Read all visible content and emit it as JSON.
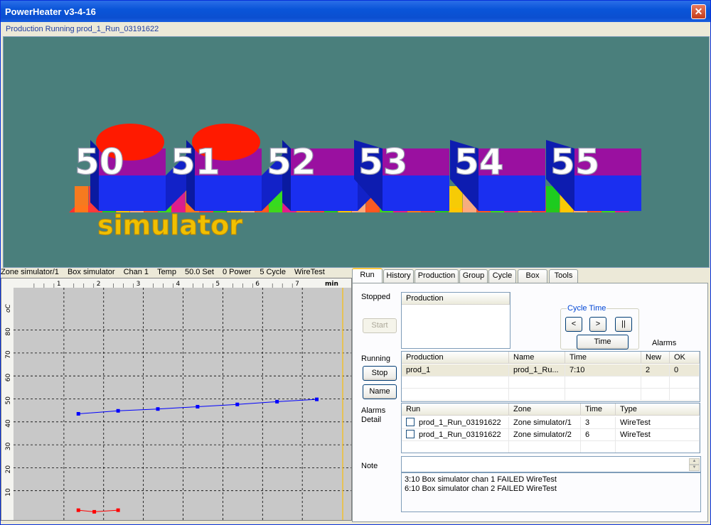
{
  "window": {
    "title": "PowerHeater  v3-4-16",
    "close_symbol": "✕",
    "status": "Production Running prod_1_Run_03191622"
  },
  "viewport": {
    "zones": [
      "50",
      "51",
      "52",
      "53",
      "54",
      "55"
    ],
    "alarm_zones": [
      "50",
      "51"
    ],
    "box_label": "simulator",
    "colors": {
      "background": "#4a7f7c",
      "box_front": "#1a2ff0",
      "box_top": "#9a10a0",
      "alarm": "#ff1a00",
      "label": "#f0c000"
    }
  },
  "chart_header": {
    "zone": "Zone simulator/1",
    "box": "Box simulator",
    "chan": "Chan 1",
    "temp": "Temp",
    "set": "50.0 Set",
    "power": "0 Power",
    "cycle": "5 Cycle",
    "test": "WireTest"
  },
  "chart_data": {
    "type": "line",
    "xlabel": "min",
    "ylabel": "oC",
    "xlim": [
      0,
      8.5
    ],
    "ylim": [
      0,
      90
    ],
    "x_ticks": [
      "1",
      "2",
      "3",
      "4",
      "5",
      "6",
      "7"
    ],
    "y_ticks": [
      "10",
      "20",
      "30",
      "40",
      "50",
      "60",
      "70",
      "80"
    ],
    "grid": true,
    "series": [
      {
        "color": "#0000ff",
        "points": [
          [
            1.4,
            43.5
          ],
          [
            2.4,
            44.8
          ],
          [
            3.4,
            45.6
          ],
          [
            4.4,
            46.6
          ],
          [
            5.4,
            47.6
          ],
          [
            6.4,
            48.8
          ],
          [
            7.4,
            49.8
          ]
        ]
      },
      {
        "color": "#ff0000",
        "points": [
          [
            1.4,
            1.5
          ],
          [
            1.8,
            0.8
          ],
          [
            2.4,
            1.5
          ]
        ]
      }
    ]
  },
  "tabs": [
    "Run",
    "History",
    "Production",
    "Group",
    "Cycle",
    "Box",
    "Tools"
  ],
  "run": {
    "stopped_label": "Stopped",
    "start_label": "Start",
    "stopped_table": {
      "header": "Production"
    },
    "cycle_time": {
      "legend": "Cycle Time",
      "prev": "<",
      "next": ">",
      "pause": "||",
      "time": "Time"
    },
    "alarms_label": "Alarms",
    "running_label": "Running",
    "stop_label": "Stop",
    "name_label": "Name",
    "running_table": {
      "headers": [
        "Production",
        "Name",
        "Time",
        "New",
        "OK"
      ],
      "rows": [
        [
          "prod_1",
          "prod_1_Ru...",
          "7:10",
          "2",
          "0"
        ]
      ]
    },
    "alarms_detail_label1": "Alarms",
    "alarms_detail_label2": "Detail",
    "alarm_table": {
      "headers": [
        "Run",
        "Zone",
        "Time",
        "Type"
      ],
      "rows": [
        [
          "prod_1_Run_03191622",
          "Zone simulator/1",
          "3",
          "WireTest"
        ],
        [
          "prod_1_Run_03191622",
          "Zone simulator/2",
          "6",
          "WireTest"
        ]
      ]
    },
    "note_label": "Note",
    "note_lines": [
      "3:10  Box simulator chan 1 FAILED WireTest",
      "6:10  Box simulator chan 2 FAILED WireTest"
    ]
  }
}
